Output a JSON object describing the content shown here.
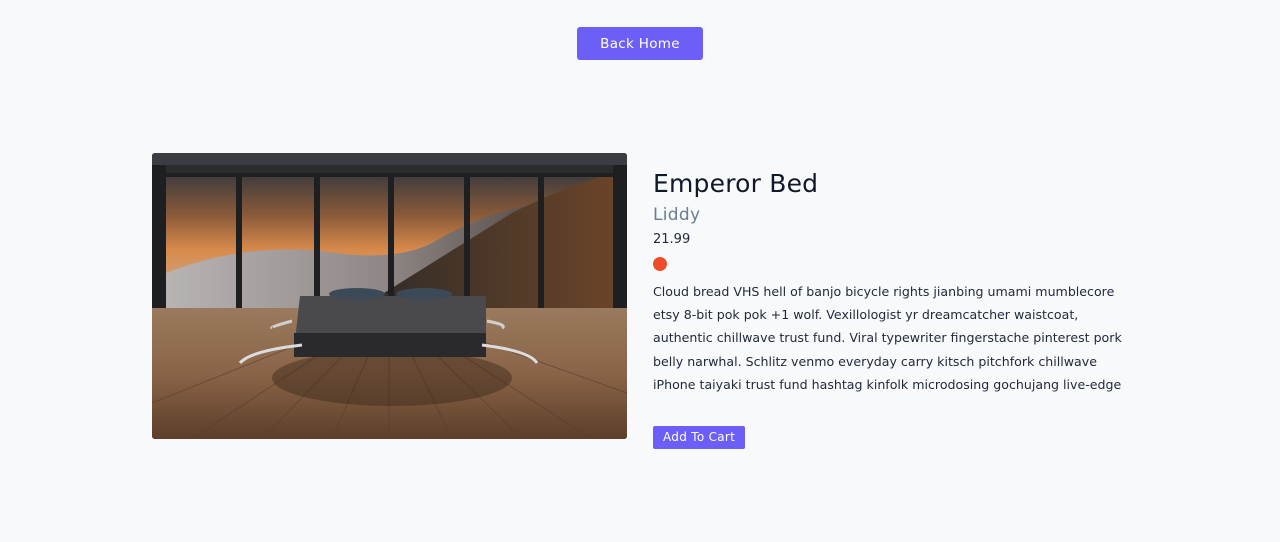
{
  "nav": {
    "back_home_label": "Back Home"
  },
  "product": {
    "title": "Emperor Bed",
    "brand": "Liddy",
    "price": "21.99",
    "color": "#ef4c2b",
    "description": "Cloud bread VHS hell of banjo bicycle rights jianbing umami mumblecore etsy 8-bit pok pok +1 wolf. Vexillologist yr dreamcatcher waistcoat, authentic chillwave trust fund. Viral typewriter fingerstache pinterest pork belly narwhal. Schlitz venmo everyday carry kitsch pitchfork chillwave iPhone taiyaki trust fund hashtag kinfolk microdosing gochujang live-edge",
    "add_to_cart_label": "Add To Cart"
  },
  "colors": {
    "accent": "#6c5ff7",
    "background": "#f8f9fb"
  }
}
